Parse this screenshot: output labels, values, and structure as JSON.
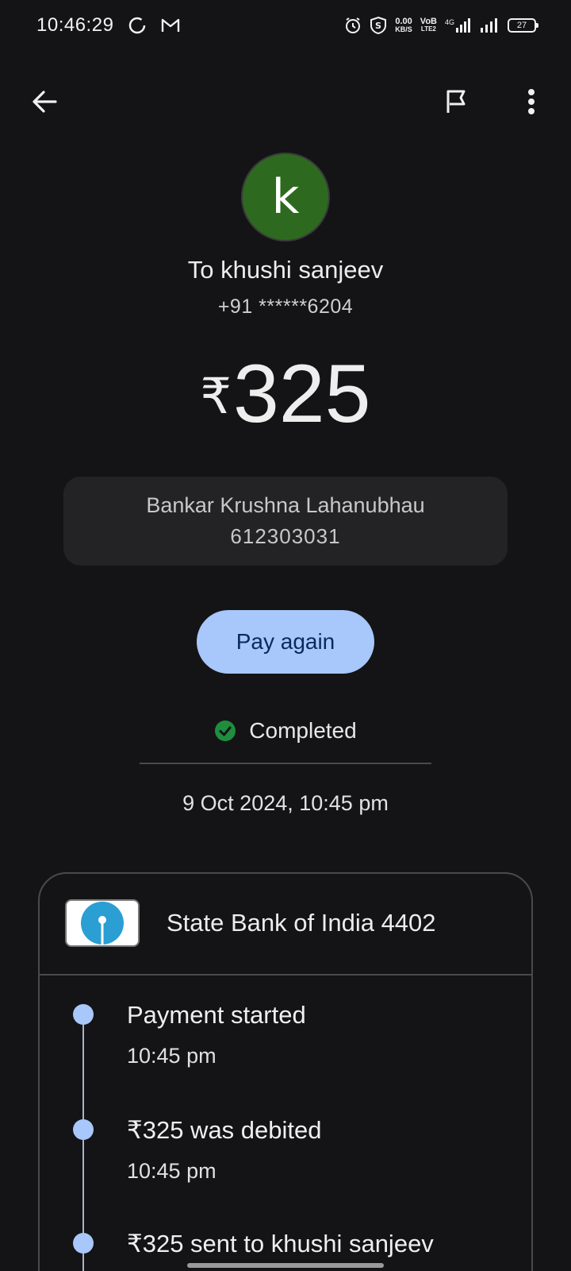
{
  "status_bar": {
    "time": "10:46:29",
    "net_speed_value": "0.00",
    "net_speed_unit": "KB/S",
    "volte_top": "VoB",
    "volte_bottom": "LTE2",
    "network_type": "4G",
    "battery": "27"
  },
  "app_bar": {
    "back_icon": "arrow-left-icon",
    "flag_icon": "flag-icon",
    "more_icon": "more-vert-icon"
  },
  "recipient": {
    "avatar_letter": "k",
    "avatar_color": "#2d6a1f",
    "name": "To khushi sanjeev",
    "phone": "+91 ******6204"
  },
  "amount": {
    "currency": "₹",
    "value": "325"
  },
  "payee": {
    "name": "Bankar Krushna Lahanubhau",
    "account": "612303031"
  },
  "actions": {
    "pay_again_label": "Pay again"
  },
  "transaction": {
    "status": "Completed",
    "status_color": "#1e8e3e",
    "datetime": "9 Oct 2024, 10:45 pm"
  },
  "bank": {
    "name": "State Bank of India 4402",
    "logo_color": "#2b9ed3"
  },
  "timeline": [
    {
      "title": "Payment started",
      "time": "10:45 pm"
    },
    {
      "title": "₹325 was debited",
      "time": "10:45 pm"
    },
    {
      "title": "₹325 sent to khushi sanjeev",
      "time": ""
    }
  ],
  "colors": {
    "accent": "#a8c7fa",
    "background": "#141416"
  }
}
